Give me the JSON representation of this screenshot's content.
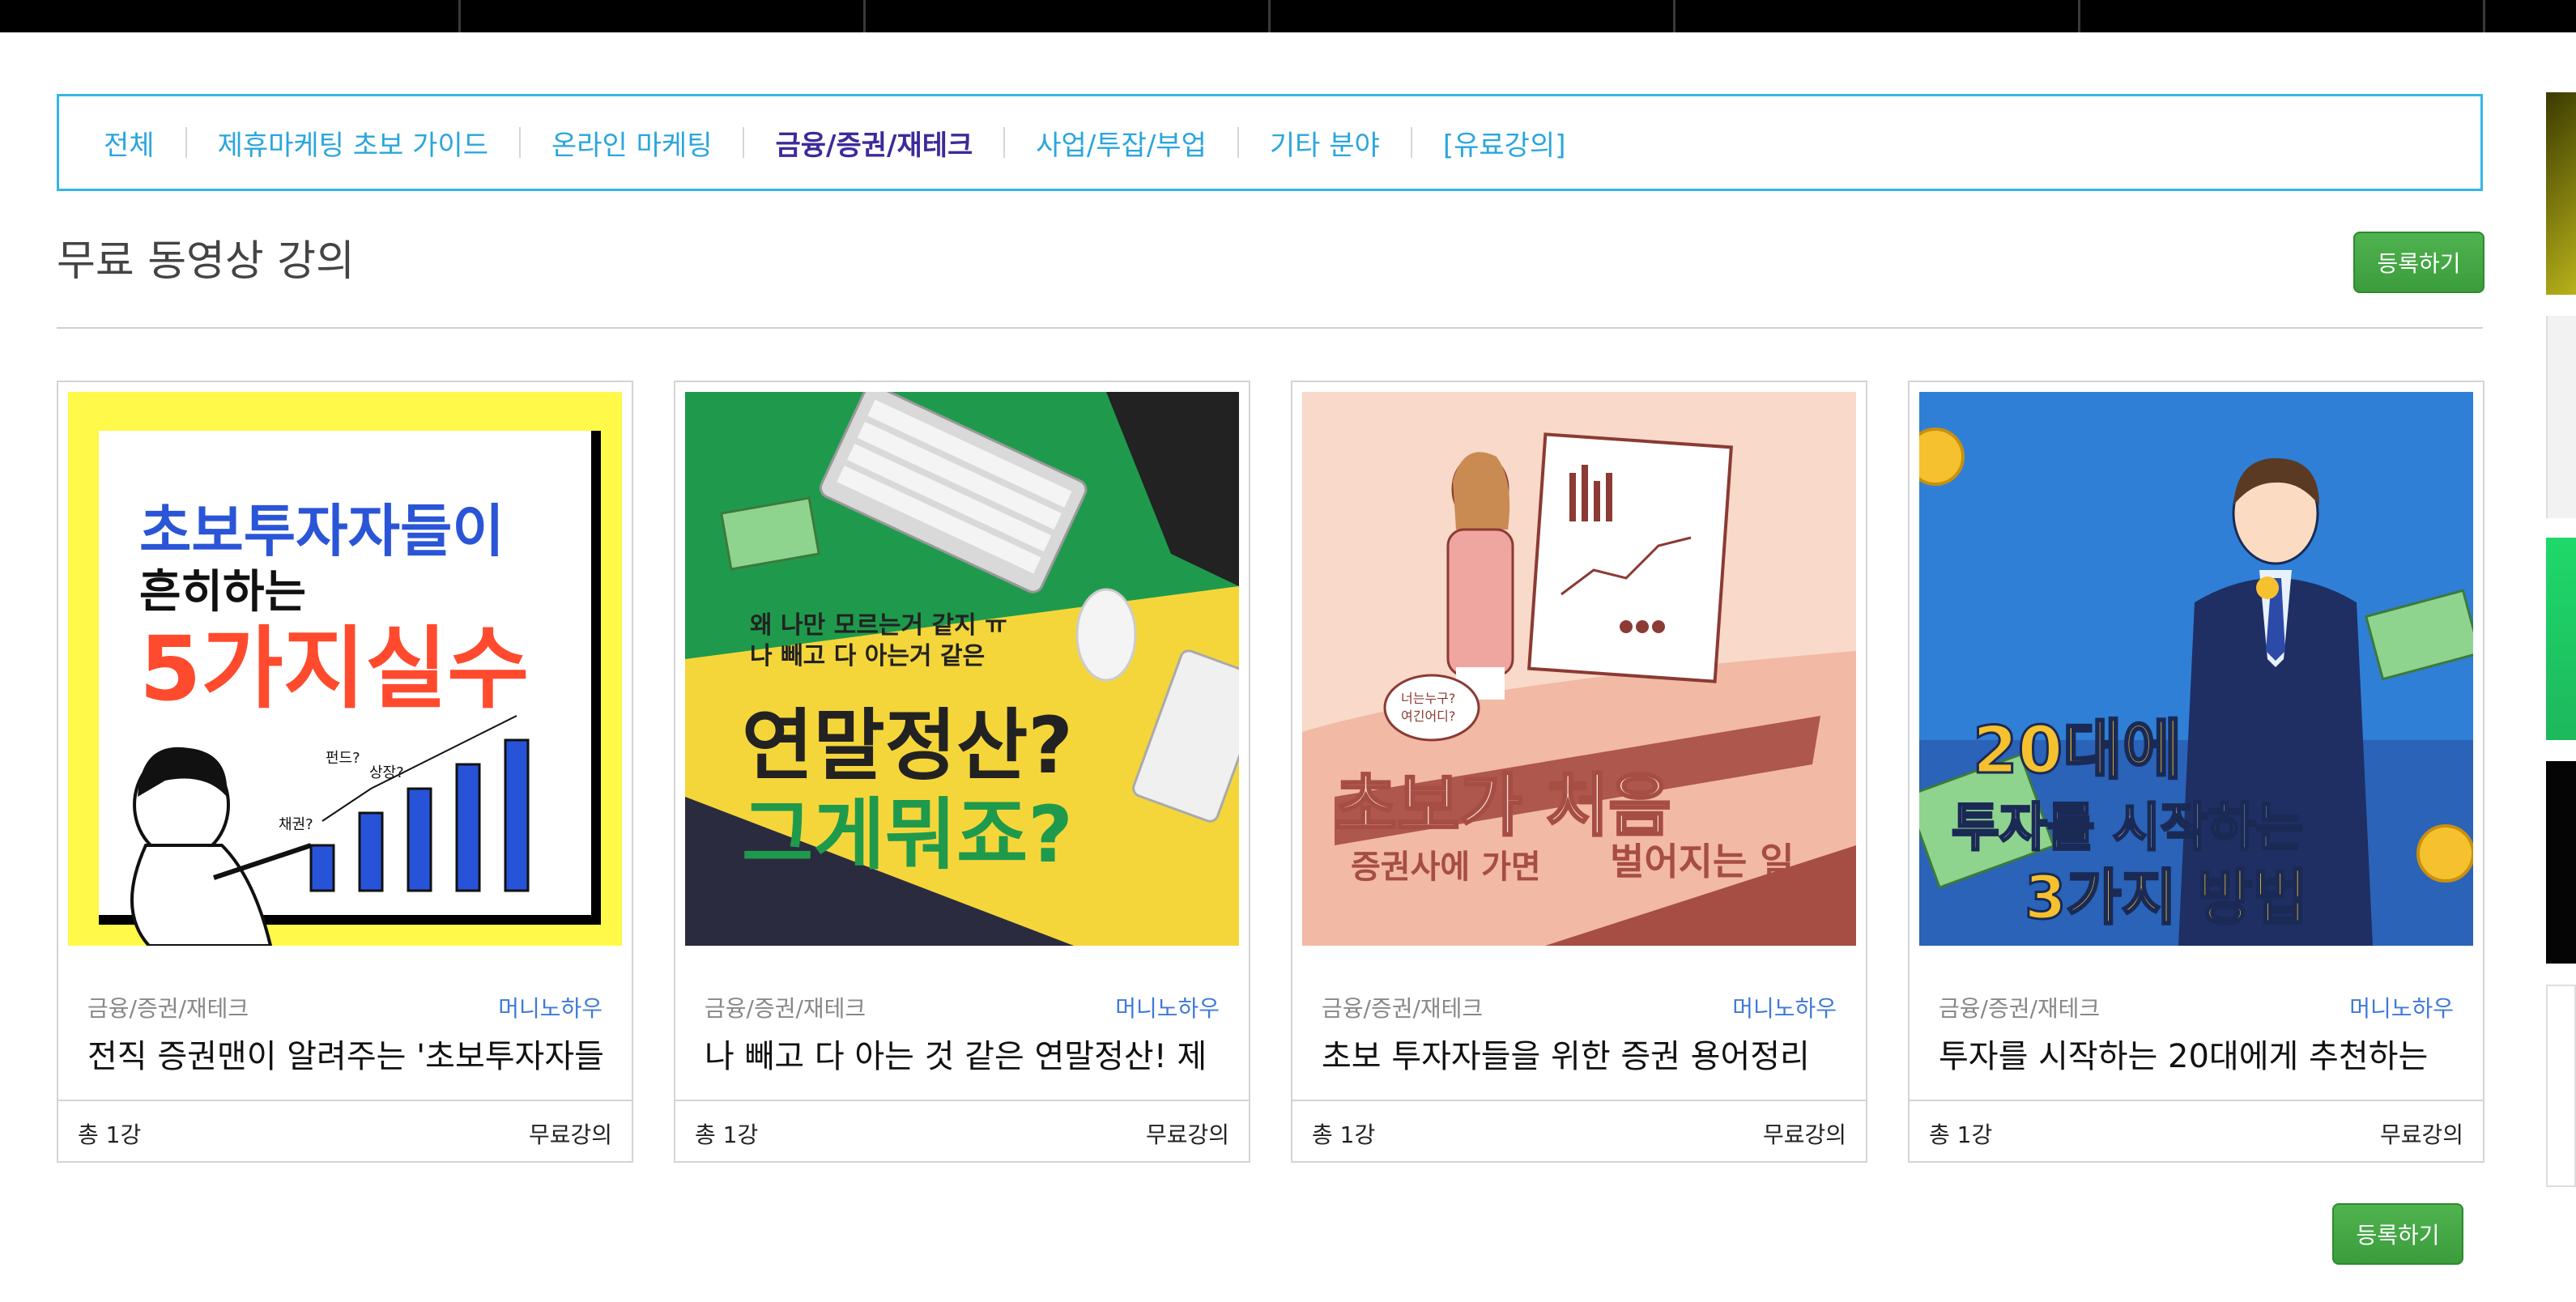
{
  "categories": [
    {
      "label": "전체",
      "active": false
    },
    {
      "label": "제휴마케팅 초보 가이드",
      "active": false
    },
    {
      "label": "온라인 마케팅",
      "active": false
    },
    {
      "label": "금융/증권/재테크",
      "active": true
    },
    {
      "label": "사업/투잡/부업",
      "active": false
    },
    {
      "label": "기타 분야",
      "active": false
    },
    {
      "label": "[유료강의]",
      "active": false
    }
  ],
  "section": {
    "title": "무료 동영상 강의",
    "register_label": "등록하기",
    "register_label_bottom": "등록하기"
  },
  "cards": [
    {
      "category": "금융/증권/재테크",
      "author": "머니노하우",
      "title": "전직 증권맨이 알려주는 '초보투자자들",
      "count": "총 1강",
      "price": "무료강의",
      "thumb": {
        "line1": "초보투자자들이",
        "line2": "흔히하는",
        "line3": "5가지실수",
        "tag1": "채권?",
        "tag2": "펀드?",
        "tag3": "상장?"
      }
    },
    {
      "category": "금융/증권/재테크",
      "author": "머니노하우",
      "title": "나 빼고 다 아는 것 같은 연말정산! 제",
      "count": "총 1강",
      "price": "무료강의",
      "thumb": {
        "line1": "왜 나만 모르는거 같지 ㅠ",
        "line2": "나 빼고 다 아는거 같은",
        "line3": "연말정산?",
        "line4": "그게뭐죠?"
      }
    },
    {
      "category": "금융/증권/재테크",
      "author": "머니노하우",
      "title": "초보 투자자들을 위한 증권 용어정리",
      "count": "총 1강",
      "price": "무료강의",
      "thumb": {
        "line1": "초보가 처음",
        "line2": "증권사에 가면",
        "line3": "벌어지는 일",
        "bubble1": "너는누구?",
        "bubble2": "여긴어디?"
      }
    },
    {
      "category": "금융/증권/재테크",
      "author": "머니노하우",
      "title": "투자를 시작하는 20대에게 추천하는",
      "count": "총 1강",
      "price": "무료강의",
      "thumb": {
        "line1": "20대에",
        "line2": "투자를 시작하는",
        "line3": "3가지 방법"
      }
    }
  ],
  "colors": {
    "accent": "#2aa6dc",
    "active_category": "#3b2b9a",
    "author": "#3f7ad6",
    "button": "#45a745"
  }
}
